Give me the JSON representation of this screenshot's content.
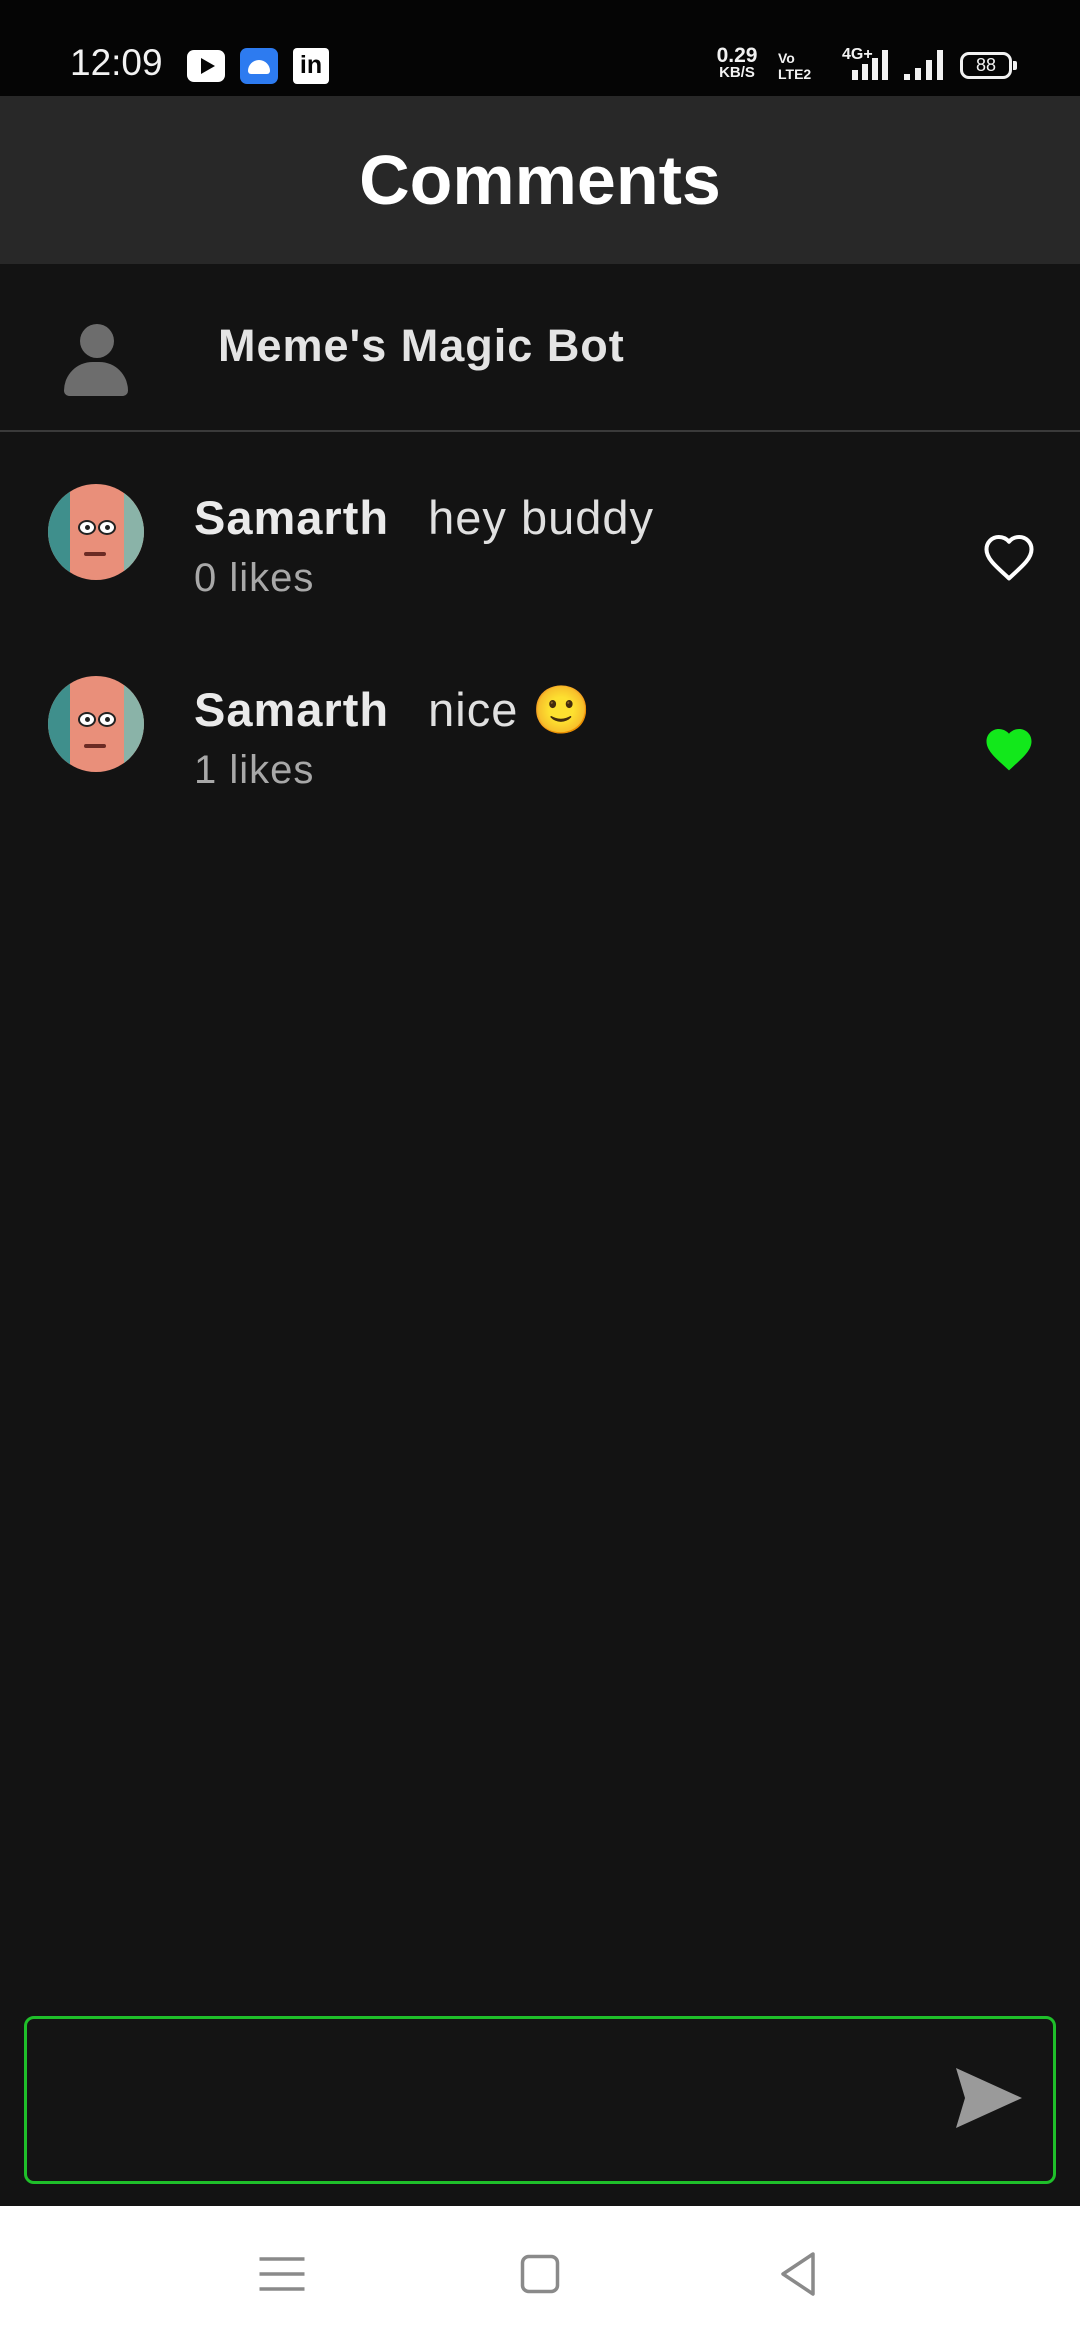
{
  "status_bar": {
    "time": "12:09",
    "notification_icons": [
      "youtube-icon",
      "android-icon",
      "linkedin-icon"
    ],
    "linkedin_glyph": "in",
    "speed_value": "0.29",
    "speed_unit": "KB/S",
    "volte_line1": "Vo",
    "volte_line2": "LTE2",
    "network": "4G+",
    "battery": "88"
  },
  "app_bar": {
    "title": "Comments"
  },
  "post": {
    "title": "Meme's Magic Bot"
  },
  "comments": [
    {
      "user": "Samarth",
      "text": "hey buddy",
      "likes": "0 likes",
      "liked": false
    },
    {
      "user": "Samarth",
      "text": "nice 🙂",
      "likes": "1 likes",
      "liked": true
    }
  ],
  "composer": {
    "placeholder": "",
    "send_icon": "send-icon"
  },
  "nav_bar": {
    "icons": [
      "menu-icon",
      "home-icon",
      "back-icon"
    ]
  },
  "colors": {
    "accent": "#1fbf2a",
    "liked_heart": "#12e81b",
    "background": "#131313",
    "app_bar": "#282828"
  }
}
